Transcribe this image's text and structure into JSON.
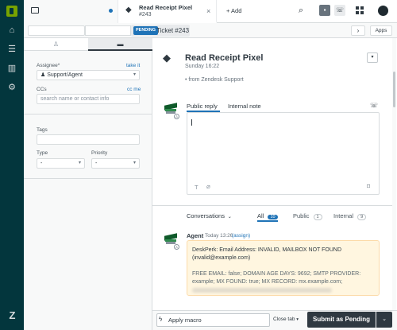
{
  "topbar": {
    "tab_title": "Read Receipt Pixel",
    "tab_subtitle": "#243",
    "close_glyph": "×",
    "add_label": "+ Add"
  },
  "header": {
    "status_badge": "PENDING",
    "ticket_label": "Ticket #243",
    "next_glyph": "›",
    "apps_label": "Apps"
  },
  "sidebar": {
    "assignee_label": "Assignee*",
    "take_it": "take it",
    "assignee_value": "Support/Agent",
    "ccs_label": "CCs",
    "cc_me": "cc me",
    "cc_placeholder": "search name or contact info",
    "tags_label": "Tags",
    "type_label": "Type",
    "type_value": "-",
    "priority_label": "Priority",
    "priority_value": "-"
  },
  "ticket": {
    "subject": "Read Receipt Pixel",
    "date": "Sunday 16:22",
    "via": "• from Zendesk Support"
  },
  "composer": {
    "public_reply": "Public reply",
    "internal_note": "Internal note"
  },
  "filters": {
    "conversations": "Conversations",
    "all": "All",
    "all_count": "10",
    "public": "Public",
    "public_count": "1",
    "internal": "Internal",
    "internal_count": "9"
  },
  "comment": {
    "author": "Agent",
    "time": "Today 13:26",
    "assign": "(assign)",
    "body1": "DeskPerk: Email Address: INVALID, MAILBOX NOT FOUND (invalid@example.com)",
    "body2": "FREE EMAIL: false; DOMAIN AGE DAYS: 9692; SMTP PROVIDER: example; MX FOUND: true; MX RECORD: mx.example.com;"
  },
  "footer": {
    "macro_label": "Apply macro",
    "close_tab": "Close tab",
    "submit_label": "Submit as Pending"
  },
  "colors": {
    "nav_bg": "#03363d",
    "accent": "#1f73b7",
    "submit_bg": "#2f3941",
    "note_bg": "#fff6e0"
  }
}
